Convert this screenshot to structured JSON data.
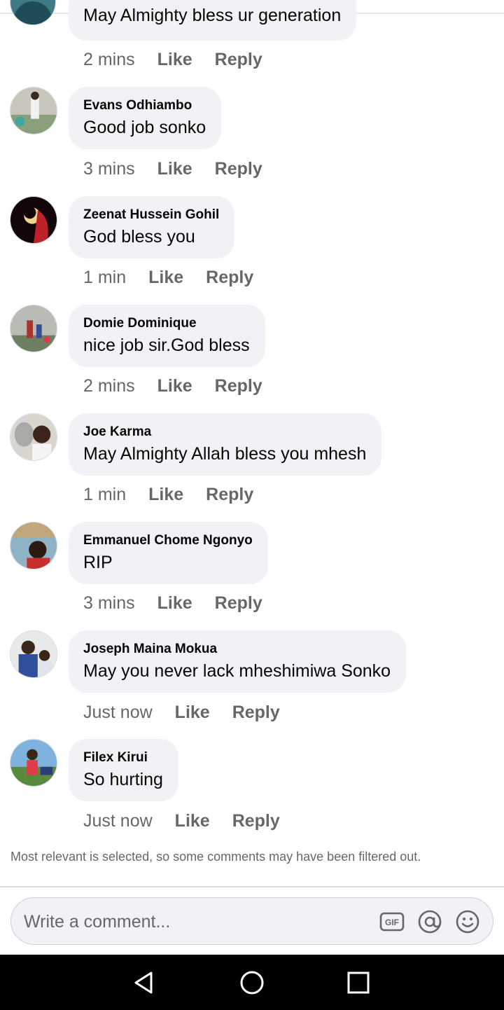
{
  "comments": [
    {
      "author": "",
      "text": "May Almighty bless ur generation",
      "time": "2 mins"
    },
    {
      "author": "Evans Odhiambo",
      "text": "Good job sonko",
      "time": "3 mins"
    },
    {
      "author": "Zeenat Hussein Gohil",
      "text": "God bless you",
      "time": "1 min"
    },
    {
      "author": "Domie Dominique",
      "text": "nice job sir.God bless",
      "time": "2 mins"
    },
    {
      "author": "Joe Karma",
      "text": "May Almighty Allah bless you mhesh",
      "time": "1 min"
    },
    {
      "author": "Emmanuel Chome Ngonyo",
      "text": "RIP",
      "time": "3 mins"
    },
    {
      "author": "Joseph Maina Mokua",
      "text": "May you never lack mheshimiwa Sonko",
      "time": "Just now"
    },
    {
      "author": "Filex Kirui",
      "text": "So hurting",
      "time": "Just now"
    }
  ],
  "actions": {
    "like": "Like",
    "reply": "Reply"
  },
  "filter_note": "Most relevant is selected, so some comments may have been filtered out.",
  "composer": {
    "placeholder": "Write a comment...",
    "gif_icon": "gif-icon",
    "mention_icon": "at-sign-icon",
    "emoji_icon": "smiley-icon"
  },
  "navigation": {
    "back_icon": "triangle-back-icon",
    "home_icon": "circle-home-icon",
    "recents_icon": "square-recents-icon"
  },
  "colors": {
    "bubble": "#f0f2f5",
    "meta_text": "#65676b",
    "text": "#050505",
    "navbar": "#000000"
  }
}
